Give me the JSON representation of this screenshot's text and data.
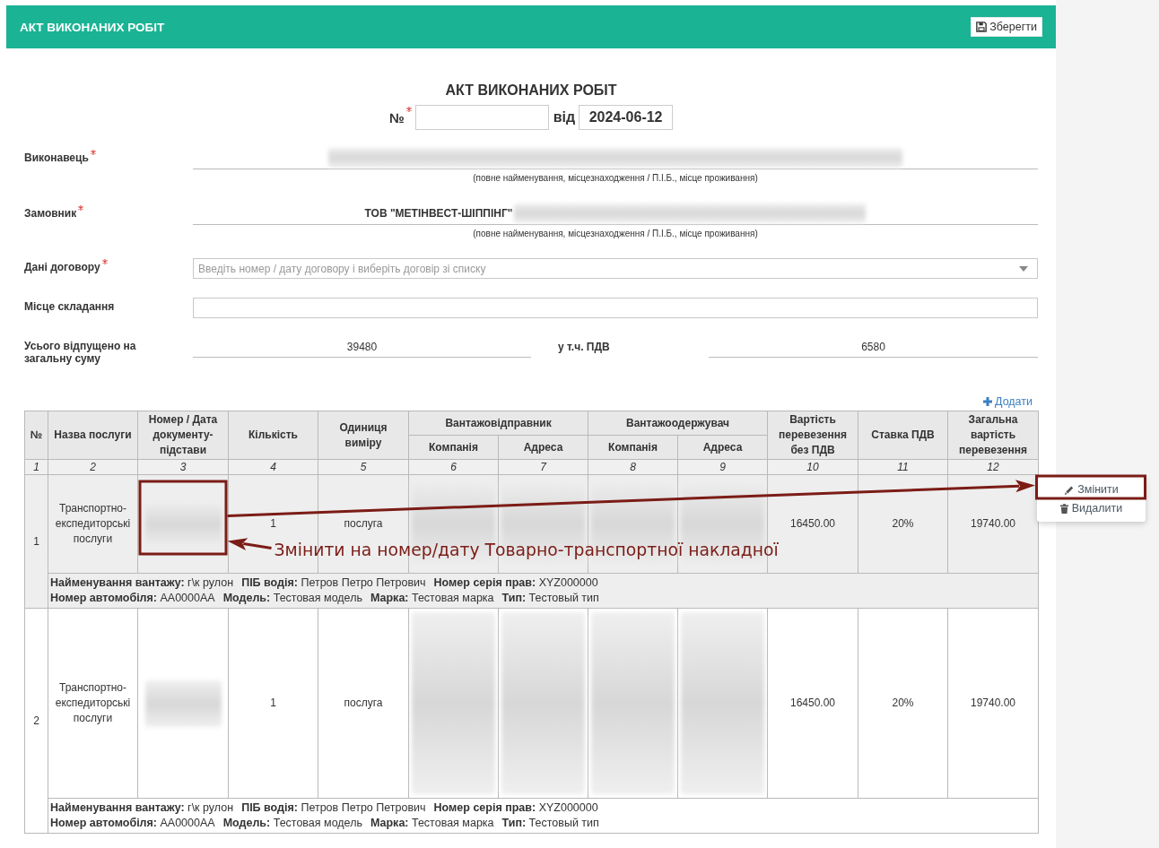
{
  "header": {
    "title": "АКТ ВИКОНАНИХ РОБІТ",
    "save_button": "Зберегти"
  },
  "document": {
    "title": "АКТ ВИКОНАНИХ РОБІТ",
    "number_label": "№",
    "number_required": true,
    "date_label": "від",
    "date": "2024-06-12"
  },
  "form": {
    "fields": [
      {
        "kind": "underlined",
        "label": "Виконавець",
        "required": true,
        "redacted": true,
        "hint": "(повне найменування, місцезнаходження / П.І.Б., місце проживання)"
      },
      {
        "kind": "underlined",
        "label": "Замовник",
        "required": true,
        "value": "ТОВ \"МЕТІНВЕСТ-ШІППІНГ\"",
        "redacted": true,
        "hint": "(повне найменування, місцезнаходження / П.І.Б., місце проживання)"
      },
      {
        "kind": "select",
        "label": "Дані договору",
        "required": true,
        "placeholder": "Введіть номер / дату договору і виберіть договір зі списку"
      },
      {
        "kind": "input",
        "label": "Місце складання",
        "required": false
      },
      {
        "kind": "totals",
        "label": "Усього відпущено на загальну суму",
        "required": false,
        "value": "39480",
        "vat_label": "у т.ч. ПДВ",
        "vat_value": "6580"
      }
    ]
  },
  "add_link": "Додати",
  "table": {
    "columns": [
      {
        "label": "№"
      },
      {
        "label": "Назва послуги"
      },
      {
        "label": "Номер / Дата документу-підстави"
      },
      {
        "label": "Кількість"
      },
      {
        "label": "Одиниця виміру"
      },
      {
        "label": "Вантажовідправник",
        "children": [
          {
            "label": "Компанія"
          },
          {
            "label": "Адреса"
          }
        ]
      },
      {
        "label": "Вантажоодержувач",
        "children": [
          {
            "label": "Компанія"
          },
          {
            "label": "Адреса"
          }
        ]
      },
      {
        "label": "Вартість перевезення без ПДВ"
      },
      {
        "label": "Ставка ПДВ"
      },
      {
        "label": "Загальна вартість перевезення"
      }
    ],
    "column_numbers": [
      "1",
      "2",
      "3",
      "4",
      "5",
      "6",
      "7",
      "8",
      "9",
      "10",
      "11",
      "12"
    ],
    "rows": [
      {
        "selected": true,
        "number": "1",
        "service": "Транспортно-експедиторські послуги",
        "quantity": "1",
        "unit": "послуга",
        "cost_without_vat": "16450.00",
        "vat_rate": "20%",
        "total_cost": "19740.00",
        "detail_lines": [
          {
            "items": [
              "**Найменування вантажу:** г\\к рулон",
              "**ПІБ водія:** Петров Петро Петрович",
              "**Номер серія прав:** XYZ000000"
            ]
          },
          {
            "items": [
              "**Номер автомобіля:** АА0000АА",
              "**Модель:** Тестовая модель",
              "**Марка:** Тестовая марка",
              "**Тип:** Тестовый тип"
            ]
          }
        ]
      },
      {
        "selected": false,
        "number": "2",
        "service": "Транспортно-експедиторські послуги",
        "quantity": "1",
        "unit": "послуга",
        "cost_without_vat": "16450.00",
        "vat_rate": "20%",
        "total_cost": "19740.00",
        "detail_lines": [
          {
            "items": [
              "**Найменування вантажу:** г\\к рулон",
              "**ПІБ водія:** Петров Петро Петрович",
              "**Номер серія прав:** XYZ000000"
            ]
          },
          {
            "items": [
              "**Номер автомобіля:** АА0000АА",
              "**Модель:** Тестовая модель",
              "**Марка:** Тестовая марка",
              "**Тип:** Тестовый тип"
            ]
          }
        ]
      }
    ]
  },
  "row_menu": {
    "items": [
      {
        "kind": "edit",
        "label": "Змінити"
      },
      {
        "kind": "delete",
        "label": "Видалити"
      }
    ]
  },
  "annotation": {
    "text": "Змінити на номер/дату Товарно-транспортної накладної"
  }
}
